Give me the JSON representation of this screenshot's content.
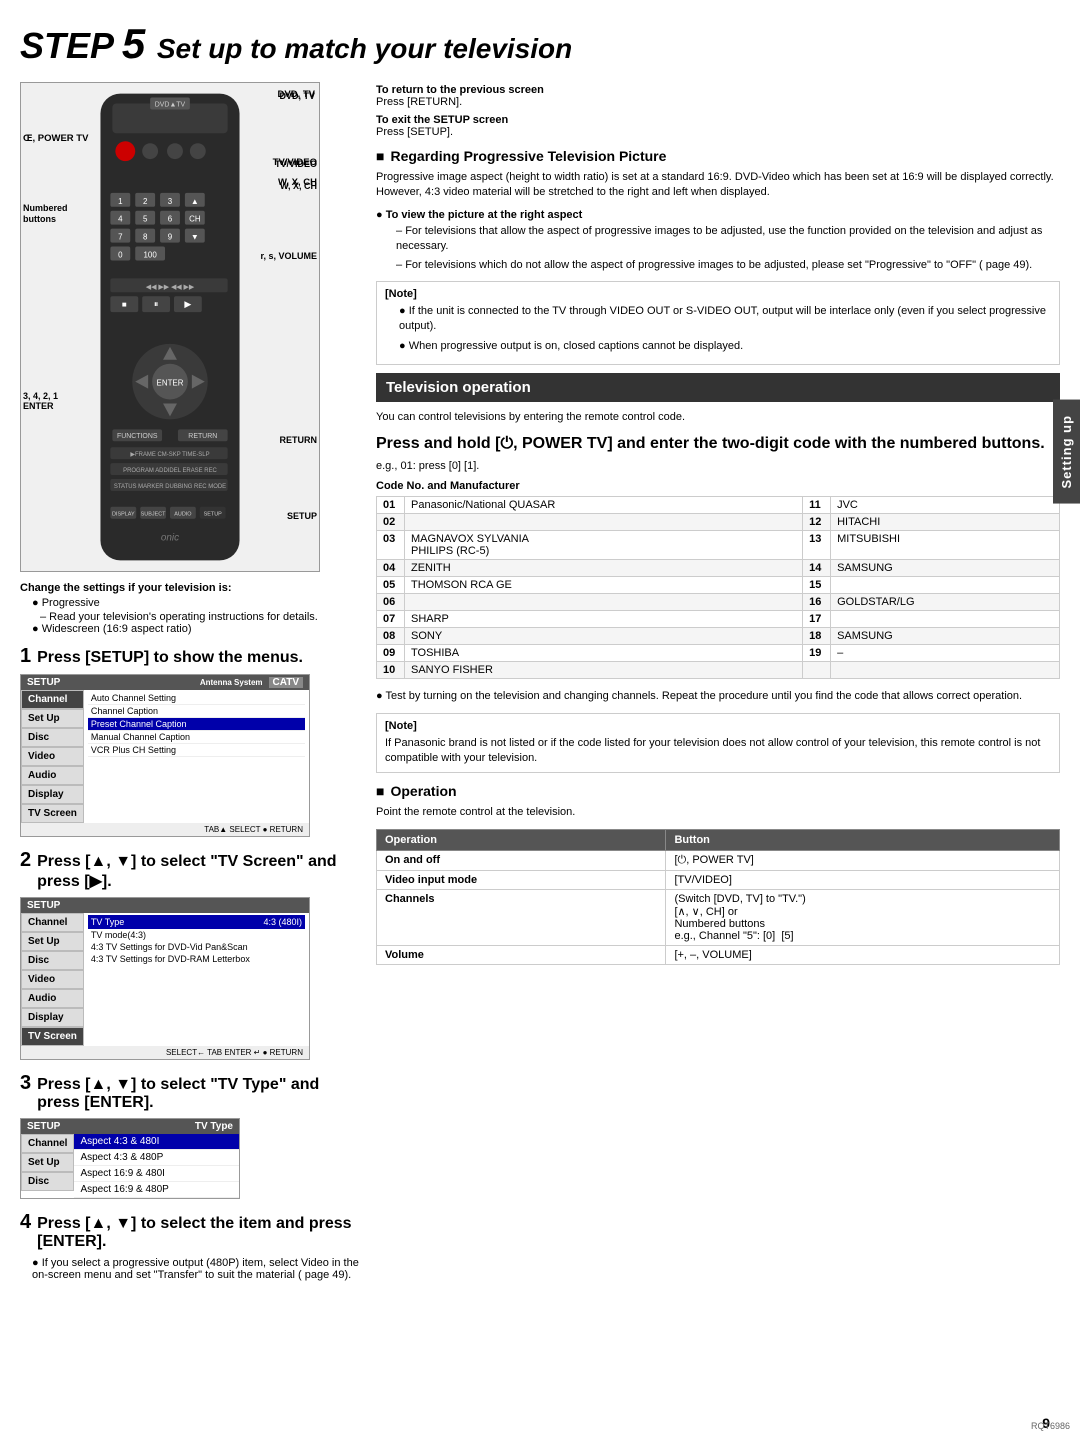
{
  "page": {
    "title_step": "STEP",
    "title_num": "5",
    "title_text": "Set up to match your television",
    "page_number": "9",
    "rqt_code": "RQT6986"
  },
  "remote": {
    "labels": {
      "dvd_tv": "DVD, TV",
      "power_tv": "Œ, POWER TV",
      "tv_video": "TV/VIDEO",
      "w_x_ch": "W, X, CH",
      "numbered": "Numbered\nbuttons",
      "volume": "r, s, VOLUME",
      "three_four": "3, 4, 2, 1",
      "enter": "ENTER",
      "return": "RETURN",
      "setup": "SETUP"
    }
  },
  "change_settings": {
    "title": "Change the settings if your television is:",
    "items": [
      {
        "label": "Progressive",
        "sub": "– Read your television's operating instructions for details."
      },
      {
        "label": "Widescreen (16:9 aspect ratio)"
      }
    ]
  },
  "steps": [
    {
      "number": "1",
      "title": "Press [SETUP] to show the menus.",
      "setup_screen": {
        "header": "SETUP",
        "catv": "CATV",
        "menu_items": [
          "Antenna System",
          "Auto Channel Setting",
          "Channel Caption",
          "Preset Channel Caption",
          "Manual Channel Caption",
          "VCR Plus CH Setting"
        ],
        "sidebar": [
          "Channel",
          "Set Up",
          "Disc",
          "Video",
          "Audio",
          "Display",
          "TV Screen"
        ],
        "active_sidebar": "Channel"
      }
    },
    {
      "number": "2",
      "title": "Press [▲, ▼] to select \"TV Screen\" and press [▶].",
      "setup_screen": {
        "header": "SETUP",
        "tv_type_label": "TV Type",
        "tv_type_value": "4:3 (480I)",
        "tv_mode_label": "TV mode(4:3)",
        "options": [
          "4:3 TV Settings for DVD-Vid Pan&Scan",
          "4:3 TV Settings for DVD-RAM Letterbox"
        ],
        "sidebar": [
          "Channel",
          "Set Up",
          "Disc",
          "Video",
          "Audio",
          "Display",
          "TV Screen"
        ],
        "active_sidebar": "TV Screen"
      }
    },
    {
      "number": "3",
      "title": "Press [▲, ▼] to select \"TV Type\" and press [ENTER].",
      "setup_screen": {
        "header": "SETUP",
        "tv_type_label": "TV Type",
        "aspect_options": [
          "Aspect 4:3 & 480I",
          "Aspect 4:3 & 480P",
          "Aspect 16:9 & 480I",
          "Aspect 16:9 & 480P"
        ],
        "selected_index": 0,
        "sidebar": [
          "Channel",
          "Set Up",
          "Disc"
        ]
      }
    },
    {
      "number": "4",
      "title": "Press [▲, ▼] to select the item and press [ENTER].",
      "notes": [
        "If you select a progressive output (480P) item, select Video in the on-screen menu and set \"Transfer\" to suit the material ( page 49)."
      ]
    }
  ],
  "right_column": {
    "return_screen": {
      "label": "To return to the previous screen",
      "value": "Press [RETURN]."
    },
    "exit_setup": {
      "label": "To exit the SETUP screen",
      "value": "Press [SETUP]."
    },
    "progressive_section": {
      "title": "Regarding Progressive Television Picture",
      "text": "Progressive image aspect (height to width ratio) is set at a standard 16:9. DVD-Video which has been set at 16:9 will be displayed correctly. However, 4:3 video material will be stretched to the right and left when displayed.",
      "bullet_title": "To view the picture at the right aspect",
      "bullets": [
        "For televisions that allow the aspect of progressive images to be adjusted, use the function provided on the television and adjust as necessary.",
        "For televisions which do not allow the aspect of progressive images to be adjusted, please set \"Progressive\" to \"OFF\" ( page 49)."
      ]
    },
    "note_section": {
      "title": "Note",
      "items": [
        "If the unit is connected to the TV through VIDEO OUT or S-VIDEO OUT, output will be interlace only (even if you select progressive output).",
        "When progressive output is on, closed captions cannot be displayed."
      ]
    },
    "tv_operation": {
      "header": "Television operation",
      "intro": "You can control televisions by entering the remote control code.",
      "instruction": "Press and hold [⏻, POWER TV] and enter the two-digit code with the numbered buttons.",
      "example": "e.g., 01:  press [0]  [1].",
      "code_table_title": "Code No. and Manufacturer",
      "code_table": [
        {
          "code": "01",
          "manufacturer": "Panasonic/National QUASAR"
        },
        {
          "code": "02",
          "manufacturer": ""
        },
        {
          "code": "03",
          "manufacturer": "MAGNAVOX SYLVANIA\nPHILIPS (RC-5)"
        },
        {
          "code": "04",
          "manufacturer": "ZENITH"
        },
        {
          "code": "05",
          "manufacturer": "THOMSON RCA GE"
        },
        {
          "code": "06",
          "manufacturer": ""
        },
        {
          "code": "07",
          "manufacturer": "SHARP"
        },
        {
          "code": "08",
          "manufacturer": "SONY"
        },
        {
          "code": "09",
          "manufacturer": "TOSHIBA"
        },
        {
          "code": "10",
          "manufacturer": "SANYO FISHER"
        },
        {
          "code": "11",
          "manufacturer": "JVC"
        },
        {
          "code": "12",
          "manufacturer": "HITACHI"
        },
        {
          "code": "13",
          "manufacturer": "MITSUBISHI"
        },
        {
          "code": "14",
          "manufacturer": "SAMSUNG"
        },
        {
          "code": "15",
          "manufacturer": ""
        },
        {
          "code": "16",
          "manufacturer": "GOLDSTAR/LG"
        },
        {
          "code": "17",
          "manufacturer": ""
        },
        {
          "code": "18",
          "manufacturer": "SAMSUNG"
        },
        {
          "code": "19",
          "manufacturer": "–"
        }
      ],
      "note_after_table": "Test by turning on the television and changing channels. Repeat the procedure until you find the code that allows correct operation.",
      "note_brand": "If Panasonic brand is not listed or if the code listed for your television does not allow control of your television, this remote control is not compatible with your television.",
      "operation_section": {
        "title": "Operation",
        "table": [
          {
            "operation": "On and off",
            "button": "[⏻, POWER TV]"
          },
          {
            "operation": "Video input mode",
            "button": "[TV/VIDEO]"
          },
          {
            "operation": "Channels",
            "button": "[∧, ∨, CH] or\nNumbered buttons\ne.g., Channel \"5\": [0]  [5]"
          },
          {
            "operation": "Volume",
            "button": "[+, –, VOLUME]"
          }
        ]
      }
    }
  },
  "sidebar_tab": "Setting up"
}
